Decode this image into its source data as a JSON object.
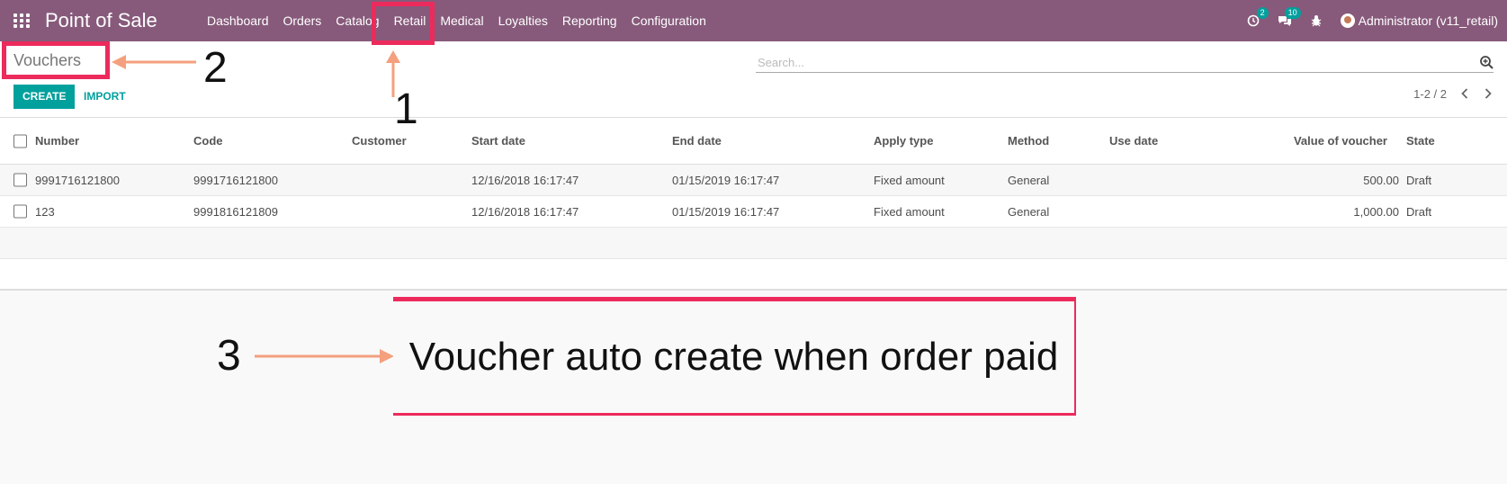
{
  "app": {
    "title": "Point of Sale"
  },
  "menu": [
    {
      "label": "Dashboard"
    },
    {
      "label": "Orders"
    },
    {
      "label": "Catalog"
    },
    {
      "label": "Retail"
    },
    {
      "label": "Medical"
    },
    {
      "label": "Loyalties"
    },
    {
      "label": "Reporting"
    },
    {
      "label": "Configuration"
    }
  ],
  "systray": {
    "activity_count": "2",
    "messages_count": "10",
    "user": "Administrator (v11_retail)"
  },
  "control_panel": {
    "title": "Vouchers",
    "search_placeholder": "Search...",
    "create_label": "CREATE",
    "import_label": "IMPORT",
    "pager": "1-2 / 2"
  },
  "table": {
    "headers": {
      "number": "Number",
      "code": "Code",
      "customer": "Customer",
      "start_date": "Start date",
      "end_date": "End date",
      "apply_type": "Apply type",
      "method": "Method",
      "use_date": "Use date",
      "value": "Value of voucher",
      "state": "State"
    },
    "rows": [
      {
        "number": "9991716121800",
        "code": "9991716121800",
        "customer": "",
        "start_date": "12/16/2018 16:17:47",
        "end_date": "01/15/2019 16:17:47",
        "apply_type": "Fixed amount",
        "method": "General",
        "use_date": "",
        "value": "500.00",
        "state": "Draft"
      },
      {
        "number": "123",
        "code": "9991816121809",
        "customer": "",
        "start_date": "12/16/2018 16:17:47",
        "end_date": "01/15/2019 16:17:47",
        "apply_type": "Fixed amount",
        "method": "General",
        "use_date": "",
        "value": "1,000.00",
        "state": "Draft"
      }
    ]
  },
  "annotations": {
    "n1": "1",
    "n2": "2",
    "n3": "3",
    "note": "Voucher auto create when order paid",
    "color": "#ec2b5c",
    "arrow_color": "#f4a07e"
  }
}
